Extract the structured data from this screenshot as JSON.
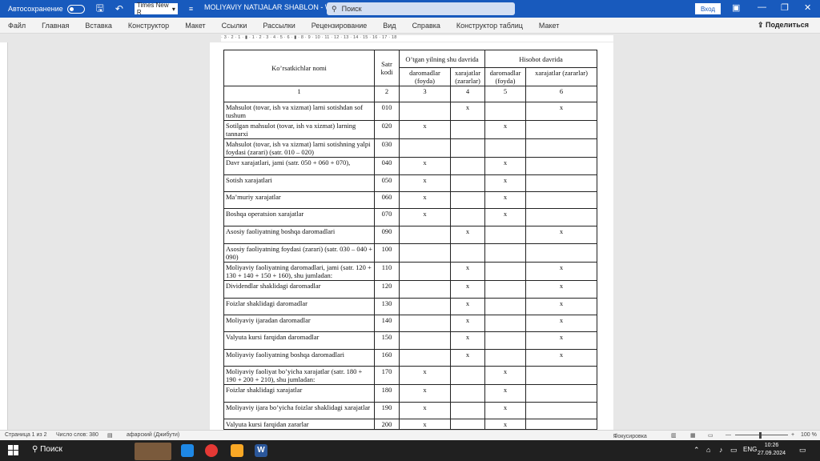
{
  "titlebar": {
    "autosave_label": "Автосохранение",
    "font_name": "Times New R",
    "doc_title": "MOLIYAVIY NATIJALAR SHABLON  -  Word",
    "search_placeholder": "Поиск",
    "signin_label": "Вход"
  },
  "ribbon": {
    "tabs": [
      "Файл",
      "Главная",
      "Вставка",
      "Конструктор",
      "Макет",
      "Ссылки",
      "Рассылки",
      "Рецензирование",
      "Вид",
      "Справка",
      "Конструктор таблиц",
      "Макет"
    ],
    "share_label": "Поделиться"
  },
  "ruler_text": "· 3 · 2 · 1 · ▮ · 1 · 2 · 3 · 4 · 5 · 6 · ▮ · 8 · 9 · 10 · 11 · 12 · 13 · 14 · 15 · 16 · 17 · 18",
  "table": {
    "header": {
      "name": "Ko’rsatkichlar nomi",
      "code": "Satr kodi",
      "prev_period": "O’tgan yilning shu davrida",
      "report_period": "Hisobot davrida",
      "income_1": "daromadlar (foyda)",
      "expense_1": "xarajatlar (zararlar)",
      "income_2": "daromadlar (foyda)",
      "expense_2": "xarajatlar (zararlar)"
    },
    "numbers": [
      "1",
      "2",
      "3",
      "4",
      "5",
      "6"
    ],
    "rows": [
      {
        "name": "Mahsulot (tovar, ish va xizmat) larni sotishdan sof tushum",
        "code": "010",
        "c3": "",
        "c4": "x",
        "c5": "",
        "c6": "x"
      },
      {
        "name": "Sotilgan mahsulot (tovar, ish va xizmat) larning tannarxi",
        "code": "020",
        "c3": "x",
        "c4": "",
        "c5": "x",
        "c6": ""
      },
      {
        "name": "Mahsulot (tovar, ish va xizmat) larni sotishning yalpi foydasi (zarari) (satr. 010 – 020)",
        "code": "030",
        "c3": "",
        "c4": "",
        "c5": "",
        "c6": ""
      },
      {
        "name": "Davr xarajatlari, jami (satr. 050 + 060 + 070),",
        "code": "040",
        "c3": "x",
        "c4": "",
        "c5": "x",
        "c6": ""
      },
      {
        "name": "Sotish xarajatlari",
        "code": "050",
        "c3": "x",
        "c4": "",
        "c5": "x",
        "c6": ""
      },
      {
        "name": "Ma’muriy xarajatlar",
        "code": "060",
        "c3": "x",
        "c4": "",
        "c5": "x",
        "c6": ""
      },
      {
        "name": "Boshqa operatsion xarajatlar",
        "code": "070",
        "c3": "x",
        "c4": "",
        "c5": "x",
        "c6": ""
      },
      {
        "name": "Asosiy faoliyatning boshqa daromadlari",
        "code": "090",
        "c3": "",
        "c4": "x",
        "c5": "",
        "c6": "x"
      },
      {
        "name": "Asosiy faoliyatning foydasi (zarari) (satr. 030 – 040 + 090)",
        "code": "100",
        "c3": "",
        "c4": "",
        "c5": "",
        "c6": ""
      },
      {
        "name": "Moliyaviy faoliyatning daromadlari, jami (satr. 120 + 130 + 140 + 150 + 160), shu jumladan:",
        "code": "110",
        "c3": "",
        "c4": "x",
        "c5": "",
        "c6": "x"
      },
      {
        "name": "Dividendlar shaklidagi daromadlar",
        "code": "120",
        "c3": "",
        "c4": "x",
        "c5": "",
        "c6": "x"
      },
      {
        "name": "Foizlar shaklidagi daromadlar",
        "code": "130",
        "c3": "",
        "c4": "x",
        "c5": "",
        "c6": "x"
      },
      {
        "name": "Moliyaviy ijaradan daromadlar",
        "code": "140",
        "c3": "",
        "c4": "x",
        "c5": "",
        "c6": "x"
      },
      {
        "name": "Valyuta kursi farqidan daromadlar",
        "code": "150",
        "c3": "",
        "c4": "x",
        "c5": "",
        "c6": "x"
      },
      {
        "name": "Moliyaviy faoliyatning boshqa daromadlari",
        "code": "160",
        "c3": "",
        "c4": "x",
        "c5": "",
        "c6": "x"
      },
      {
        "name": "Moliyaviy faoliyat bo’yicha xarajatlar (satr. 180 + 190 + 200 + 210), shu jumladan:",
        "code": "170",
        "c3": "x",
        "c4": "",
        "c5": "x",
        "c6": ""
      },
      {
        "name": "Foizlar shaklidagi xarajatlar",
        "code": "180",
        "c3": "x",
        "c4": "",
        "c5": "x",
        "c6": ""
      },
      {
        "name": "Moliyaviy ijara bo’yicha foizlar shaklidagi xarajatlar",
        "code": "190",
        "c3": "x",
        "c4": "",
        "c5": "x",
        "c6": ""
      },
      {
        "name": "Valyuta kursi farqidan zararlar",
        "code": "200",
        "c3": "x",
        "c4": "",
        "c5": "x",
        "c6": ""
      }
    ]
  },
  "statusbar": {
    "page": "Страница 1 из 2",
    "words": "Число слов: 380",
    "language": "афарский (Джибути)",
    "focus": "Фокусировка",
    "zoom": "100 %"
  },
  "taskbar": {
    "search": "Поиск",
    "lang": "ENG",
    "time": "10:26",
    "date": "27.09.2024"
  }
}
